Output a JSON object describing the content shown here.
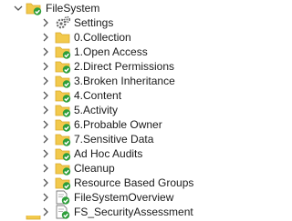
{
  "tree": {
    "root": {
      "label": "FileSystem",
      "icon": "folder-check-icon",
      "expanded": true
    },
    "items": [
      {
        "label": "Settings",
        "icon": "gears-icon",
        "kind": "settings"
      },
      {
        "label": "0.Collection",
        "icon": "folder-icon",
        "kind": "folder"
      },
      {
        "label": "1.Open Access",
        "icon": "folder-check-icon",
        "kind": "folder-check"
      },
      {
        "label": "2.Direct Permissions",
        "icon": "folder-check-icon",
        "kind": "folder-check"
      },
      {
        "label": "3.Broken Inheritance",
        "icon": "folder-check-icon",
        "kind": "folder-check"
      },
      {
        "label": "4.Content",
        "icon": "folder-check-icon",
        "kind": "folder-check"
      },
      {
        "label": "5.Activity",
        "icon": "folder-check-icon",
        "kind": "folder-check"
      },
      {
        "label": "6.Probable Owner",
        "icon": "folder-check-icon",
        "kind": "folder-check"
      },
      {
        "label": "7.Sensitive Data",
        "icon": "folder-check-icon",
        "kind": "folder-check"
      },
      {
        "label": "Ad Hoc Audits",
        "icon": "folder-check-icon",
        "kind": "folder-check"
      },
      {
        "label": "Cleanup",
        "icon": "folder-check-icon",
        "kind": "folder-check"
      },
      {
        "label": "Resource Based Groups",
        "icon": "folder-check-icon",
        "kind": "folder-check"
      },
      {
        "label": "FileSystemOverview",
        "icon": "job-check-icon",
        "kind": "job-check"
      },
      {
        "label": "FS_SecurityAssessment",
        "icon": "job-check-icon",
        "kind": "job-check"
      }
    ]
  },
  "colors": {
    "folder": "#f2c94c",
    "folder_dark": "#d9a928",
    "check": "#2e9e3a",
    "chevron": "#555555",
    "gear": "#6b6b6b"
  }
}
